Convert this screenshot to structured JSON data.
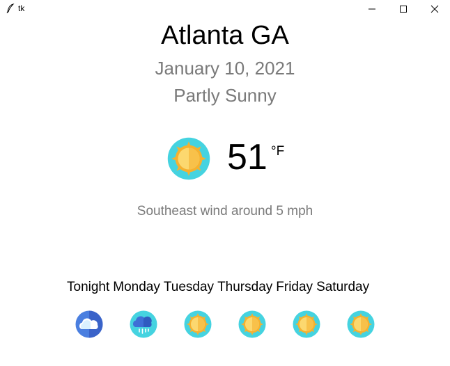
{
  "window": {
    "title": "tk",
    "controls": [
      "minimize",
      "maximize",
      "close"
    ]
  },
  "location": "Atlanta GA",
  "date": "January 10, 2021",
  "condition": "Partly Sunny",
  "current": {
    "icon": "sun-icon",
    "temperature": "51",
    "unit": "°F"
  },
  "wind": "Southeast wind around 5 mph",
  "forecast": [
    {
      "day": "Tonight",
      "icon": "cloud-icon"
    },
    {
      "day": "Monday",
      "icon": "rain-cloud-icon"
    },
    {
      "day": "Tuesday",
      "icon": "sun-icon"
    },
    {
      "day": "Thursday",
      "icon": "sun-icon"
    },
    {
      "day": "Friday",
      "icon": "sun-icon"
    },
    {
      "day": "Saturday",
      "icon": "sun-icon"
    }
  ],
  "colors": {
    "sun_ring": "#45d3e0",
    "sun_rays": "#f5b130",
    "sun_core": "#fcd86f",
    "cloud_night_bg": "#4a7fe0",
    "rain_bg": "#45d3e0",
    "rain_cloud": "#3e6fd6",
    "text_secondary": "#7a7a7a"
  }
}
